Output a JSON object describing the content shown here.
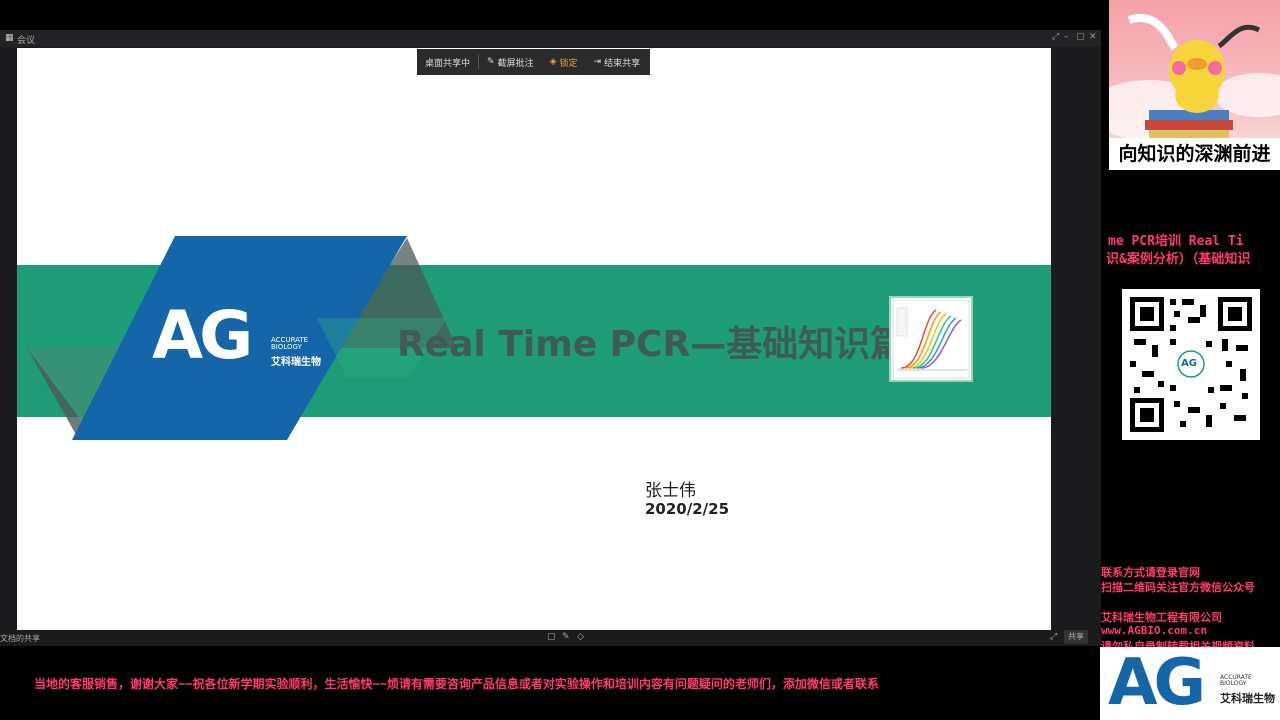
{
  "window": {
    "title": "会议",
    "controls": [
      "⤢",
      "–",
      "▢",
      "✕"
    ]
  },
  "share_toolbar": {
    "sharing_status": "桌面共享中",
    "annotate_label": "截屏批注",
    "lock_label": "锁定",
    "end_label": "结束共享"
  },
  "slide": {
    "logo_text": "AG",
    "logo_sub_en": [
      "ACCURATE",
      "BIOLOGY"
    ],
    "logo_sub_cn": "艾科瑞生物",
    "title": "Real Time PCR—基础知识篇",
    "presenter": "张士伟",
    "date": "2020/2/25",
    "colors": {
      "green": "#1e9c77",
      "blue": "#1466a8",
      "title_text": "#3f5b53"
    }
  },
  "bottom_bar": {
    "left_text": "文档的共享",
    "right_label": "共享"
  },
  "side_panel": {
    "cover_caption": "向知识的深渊前进",
    "course_line1": "me PCR培训    Real Ti",
    "course_line2": "识&案例分析）（基础知识",
    "qr_label": "AG",
    "contact_line1": "联系方式请登录官网",
    "contact_line2": "扫描二维码关注官方微信公众号",
    "company": "艾科瑞生物工程有限公司",
    "website": "www.AGBIO.com.cn",
    "warning": "请勿私自录制转载相关视频资料",
    "footer_logo_text": "AG",
    "footer_logo_sub_en": [
      "ACCURATE",
      "BIOLOGY"
    ],
    "footer_logo_cn": "艾科瑞生物",
    "text_color": "#ff3b6b"
  },
  "marquee": {
    "text": "当地的客服销售，谢谢大家~~祝各位新学期实验顺利，生活愉快~~烦请有需要咨询产品信息或者对实验操作和培训内容有问题疑问的老师们，添加微信或者联系"
  }
}
